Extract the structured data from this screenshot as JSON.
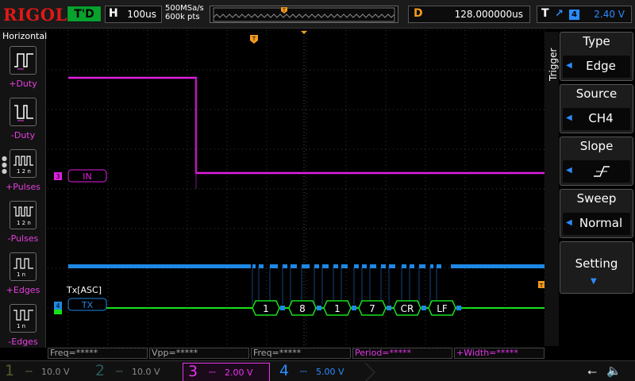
{
  "brand": "RIGOL",
  "status": "T'D",
  "horizontal": {
    "label": "H",
    "timebase": "100us",
    "sample_rate": "500MSa/s",
    "memory_depth": "600k pts"
  },
  "delay": {
    "label": "D",
    "value": "128.000000us"
  },
  "trigger_status": {
    "label": "T",
    "channel": "4",
    "level": "2.40 V"
  },
  "left_menu": {
    "title": "Horizontal",
    "items": [
      {
        "label": "+Duty",
        "icon": "pos-duty-icon"
      },
      {
        "label": "-Duty",
        "icon": "neg-duty-icon"
      },
      {
        "label": "+Pulses",
        "icon": "pos-pulses-icon"
      },
      {
        "label": "-Pulses",
        "icon": "neg-pulses-icon"
      },
      {
        "label": "+Edges",
        "icon": "pos-edges-icon"
      },
      {
        "label": "-Edges",
        "icon": "neg-edges-icon"
      }
    ]
  },
  "channel3_label": "IN",
  "channel4_label": "TX",
  "decode": {
    "title": "Tx[ASC]",
    "bytes": [
      "1",
      "8",
      "1",
      "7",
      "CR",
      "LF"
    ]
  },
  "right_menu": {
    "side_label": "Trigger",
    "type": {
      "title": "Type",
      "value": "Edge"
    },
    "source": {
      "title": "Source",
      "value": "CH4"
    },
    "slope": {
      "title": "Slope"
    },
    "sweep": {
      "title": "Sweep",
      "value": "Normal"
    },
    "setting": {
      "title": "Setting"
    }
  },
  "measurements": [
    "Freq=*****",
    "Vpp=*****",
    "Freq=*****",
    "Period=*****",
    "+Width=*****"
  ],
  "channels": [
    {
      "num": "1",
      "scale": "10.0 V",
      "color": "#b2b200"
    },
    {
      "num": "2",
      "scale": "10.0 V",
      "color": "#00b5b5"
    },
    {
      "num": "3",
      "scale": "2.00 V",
      "color": "#e535e8"
    },
    {
      "num": "4",
      "scale": "5.00 V",
      "color": "#2a8cff"
    }
  ],
  "colors": {
    "ch3": "#e020e0",
    "ch4": "#1e88e5",
    "decode": "#19e019",
    "trigger": "#f39a1e"
  }
}
